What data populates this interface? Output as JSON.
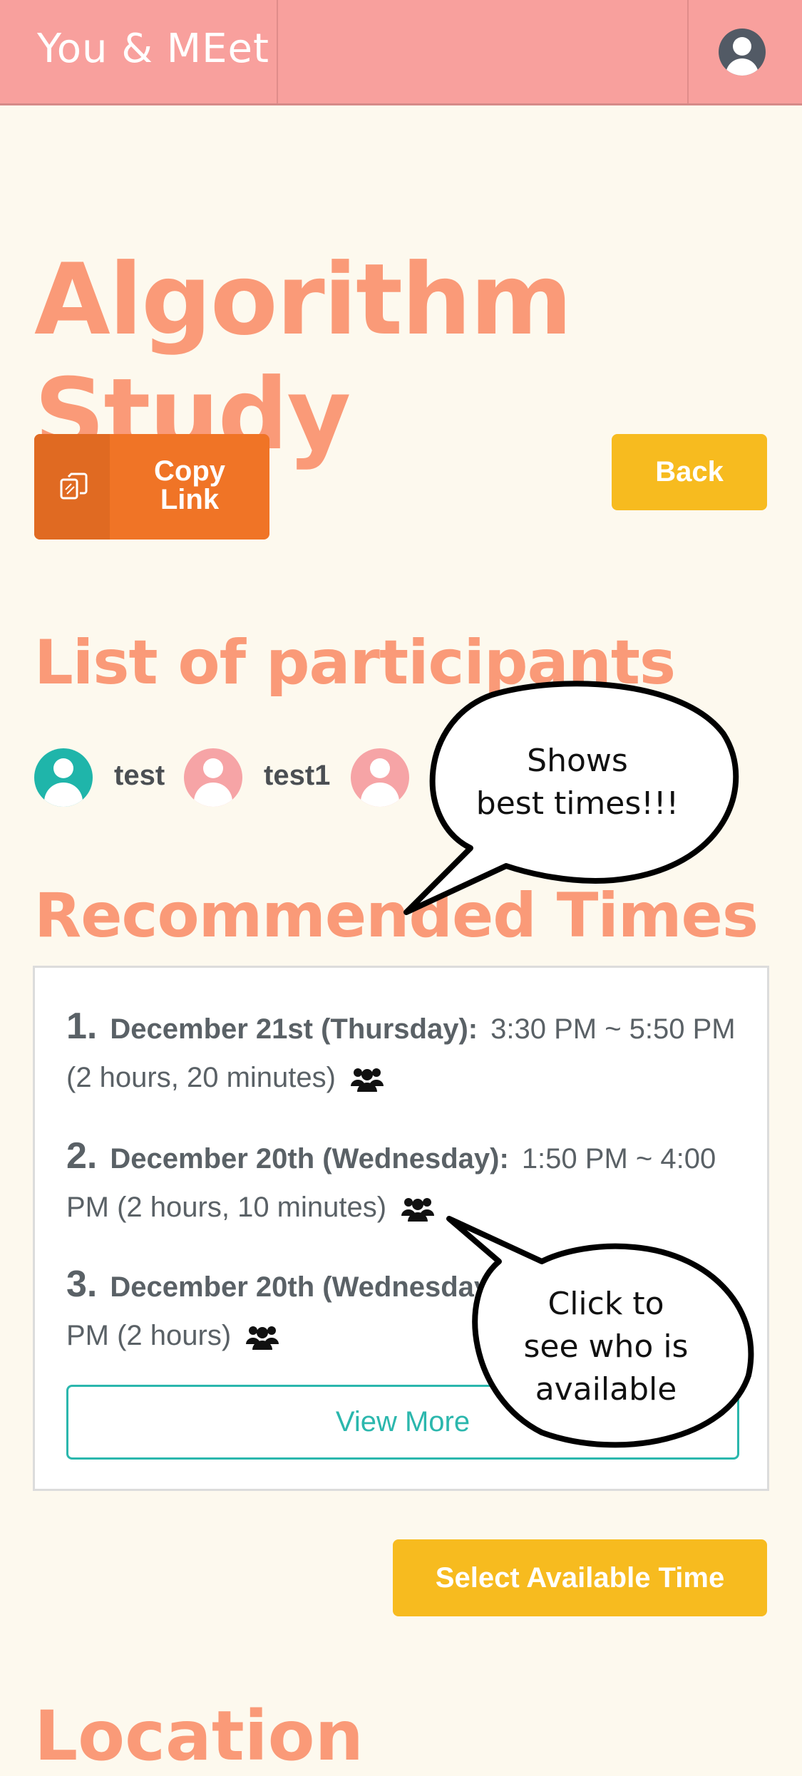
{
  "header": {
    "brand": "You & MEet"
  },
  "meeting": {
    "title": "Algorithm Study"
  },
  "actions": {
    "copy_link_label": "Copy\nLink",
    "back_label": "Back"
  },
  "participants": {
    "heading": "List of participants",
    "items": [
      {
        "name": "test",
        "avatar_color": "#1fb5aa"
      },
      {
        "name": "test1",
        "avatar_color": "#f6a4a6"
      },
      {
        "name": "",
        "avatar_color": "#f6a4a6"
      }
    ]
  },
  "recommended": {
    "heading": "Recommended Times",
    "items": [
      {
        "num": "1.",
        "date": "December 21st (Thursday):",
        "detail": "3:30 PM ~ 5:50 PM (2 hours, 20 minutes)"
      },
      {
        "num": "2.",
        "date": "December 20th (Wednesday):",
        "detail": "1:50 PM ~ 4:00 PM (2 hours, 10 minutes)"
      },
      {
        "num": "3.",
        "date": "December 20th (Wednesday):",
        "detail": "PM (2 hours)"
      }
    ],
    "view_more_label": "View More"
  },
  "select_time_label": "Select Available Time",
  "location": {
    "heading": "Location"
  },
  "annotations": {
    "best_times": "Shows\nbest times!!!",
    "who_available": "Click to\nsee who is\navailable"
  },
  "colors": {
    "header_bg": "#f8a09d",
    "accent_salmon": "#fa9a78",
    "orange_button": "#f07426",
    "yellow_button": "#f7bb1f",
    "teal": "#2bb7ad"
  },
  "icons": {
    "copy": "copy-icon",
    "profile": "user-circle-icon",
    "group": "users-group-icon"
  }
}
